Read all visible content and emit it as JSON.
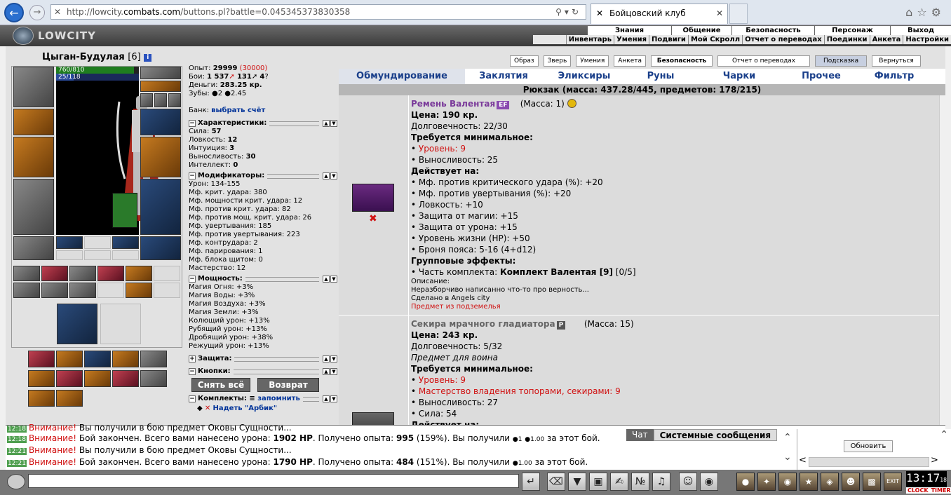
{
  "browser": {
    "url_prefix": "http://lowcity.",
    "url_host": "combats.com",
    "url_path": "/buttons.pl?battle=0.045345373830358",
    "tab_title": "Бойцовский клуб"
  },
  "game": {
    "logo": "LOWCITY",
    "nav_top": [
      "Знания",
      "Общение",
      "Безопасность",
      "Персонаж",
      "Выход"
    ],
    "nav_sub": [
      "Инвентарь",
      "Умения",
      "Подвиги",
      "Мой Скролл",
      "Отчет о переводах",
      "Поединки",
      "Анкета",
      "Настройки"
    ]
  },
  "character": {
    "name": "Цыган-Будулая",
    "level": "[6]",
    "hp": "760/810",
    "mp": "25/118",
    "hp_fraction": 0.94,
    "mp_fraction": 0.21,
    "exp_label": "Опыт:",
    "exp_value": "29999",
    "exp_next": "(30000)",
    "battles_label": "Бои:",
    "battles_win": "1 537",
    "battles_loss": "131",
    "battles_draw": "4",
    "money_label": "Деньги:",
    "money_value": "283.25 кр.",
    "teeth_label": "Зубы:",
    "teeth_value": "2",
    "teeth_value2": "2.45",
    "bank_label": "Банк:",
    "bank_link": "выбрать счёт"
  },
  "sections": {
    "characteristics": {
      "title": "Характеристики:",
      "rows": [
        {
          "k": "Сила:",
          "v": "57"
        },
        {
          "k": "Ловкость:",
          "v": "12"
        },
        {
          "k": "Интуиция:",
          "v": "3"
        },
        {
          "k": "Выносливость:",
          "v": "30"
        },
        {
          "k": "Интеллект:",
          "v": "0"
        }
      ]
    },
    "modifiers": {
      "title": "Модификаторы:",
      "rows": [
        "Урон: 134-155",
        "Мф. крит. удара: 380",
        "Мф. мощности крит. удара: 12",
        "Мф. против крит. удара: 82",
        "Мф. против мощ. крит. удара: 26",
        "Мф. увертывания: 185",
        "Мф. против увертывания: 223",
        "Мф. контрудара: 2",
        "Мф. парирования: 1",
        "Мф. блока щитом: 0",
        "Мастерство: 12"
      ]
    },
    "powers": {
      "title": "Мощность:",
      "rows": [
        "Магия Огня: +3%",
        "Магия Воды: +3%",
        "Магия Воздуха: +3%",
        "Магия Земли: +3%",
        "Колющий урон: +13%",
        "Рубящий урон: +13%",
        "Дробящий урон: +38%",
        "Режущий урон: +13%"
      ]
    },
    "protection": {
      "title": "Защита:"
    },
    "buttons": {
      "title": "Кнопки:"
    },
    "sets": {
      "title": "Комплекты:",
      "link": "запомнить",
      "item": "Надеть \"Арбик\""
    }
  },
  "actions": {
    "remove_all": "Снять всё",
    "return": "Возврат"
  },
  "top_buttons": [
    "Образ",
    "Зверь",
    "Умения",
    "Анкета",
    "Безопасность",
    "Отчет о переводах",
    "Подсказка",
    "Вернуться"
  ],
  "inventory_tabs": [
    "Обмундирование",
    "Заклятия",
    "Эликсиры",
    "Руны",
    "Чарки",
    "Прочее",
    "Фильтр"
  ],
  "backpack": "Рюкзак (масса: 437.28/445, предметов: 178/215)",
  "items": [
    {
      "name": "Ремень Валентая",
      "badge": "EF",
      "mass": "(Масса: 1)",
      "price": "Цена: 190 кр.",
      "durability": "Долговечность: 22/30",
      "req_title": "Требуется минимальное:",
      "req": [
        {
          "text": "Уровень: 9",
          "red": true
        },
        {
          "text": "Выносливость: 25",
          "red": false
        }
      ],
      "effect_title": "Действует на:",
      "effects": [
        "Мф. против критического удара (%): +20",
        "Мф. против увертывания (%): +20",
        "Ловкость: +10",
        "Защита от магии: +15",
        "Защита от урона: +15",
        "Уровень жизни (HP): +50",
        "Броня пояса: 5-16 (4+d12)"
      ],
      "group_title": "Групповые эффекты:",
      "group_prefix": "• Часть комплекта: ",
      "group_name": "Комплект Валентая [9]",
      "group_count": " [0/5]",
      "desc_title": "Описание:",
      "desc": "Неразборчиво написанно что-то про верность...",
      "made": "Сделано в Angels city",
      "origin": "Предмет из подземелья"
    },
    {
      "name": "Секира мрачного гладиатора",
      "badge": "P",
      "mass": "(Масса: 15)",
      "price": "Цена: 243 кр.",
      "durability": "Долговечность: 5/32",
      "for_class": "Предмет для воина",
      "req_title": "Требуется минимальное:",
      "req": [
        {
          "text": "Уровень: 9",
          "red": true
        },
        {
          "text": "Мастерство владения топорами, секирами: 9",
          "red": true
        },
        {
          "text": "Выносливость: 27",
          "red": false
        },
        {
          "text": "Сила: 54",
          "red": false
        }
      ],
      "effect_title": "Действует на:"
    }
  ],
  "chat": {
    "tabs": [
      "Чат",
      "Системные сообщения"
    ],
    "lines": [
      {
        "time": "12:18",
        "warn": "Внимание!",
        "text": " Вы получили в бою предмет Оковы Сущности..."
      },
      {
        "time": "12:18",
        "warn": "Внимание!",
        "pre": " Бой закончен. Всего вами нанесено урона: ",
        "b1": "1902 HP",
        "mid": ". Получено опыта: ",
        "b2": "995",
        "post": " (159%). Вы получили ",
        "coin1": "1",
        "coin2": "1.00",
        "end": " за этот бой."
      },
      {
        "time": "12:21",
        "warn": "Внимание!",
        "text": " Вы получили в бою предмет Оковы Сущности..."
      },
      {
        "time": "12:21",
        "warn": "Внимание!",
        "pre": " Бой закончен. Всего вами нанесено урона: ",
        "b1": "1790 HP",
        "mid": ". Получено опыта: ",
        "b2": "484",
        "post": " (151%). Вы получили ",
        "coin2": "1.00",
        "end": " за этот бой."
      }
    ],
    "refresh": "Обновить"
  },
  "clock": {
    "time": "13:17",
    "sec": "18",
    "clock_label": "CLOCK",
    "timer_label": "TIMER",
    "exit_label": "EXIT"
  },
  "colors": {
    "accent": "#1a3f8a",
    "warn": "#d01010",
    "hp": "#1f7d1f",
    "mp": "#2a4a9a"
  }
}
